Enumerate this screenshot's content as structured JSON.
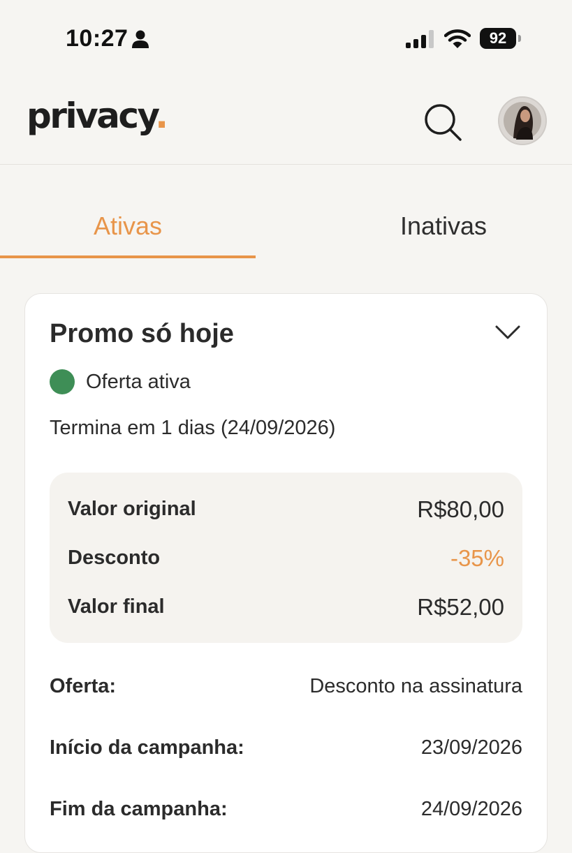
{
  "status_bar": {
    "time": "10:27",
    "battery": "92"
  },
  "header": {
    "logo_text": "privacy",
    "logo_dot": ".",
    "brand_color": "#e8954a"
  },
  "tabs": [
    {
      "label": "Ativas",
      "active": true
    },
    {
      "label": "Inativas",
      "active": false
    }
  ],
  "card": {
    "title": "Promo só hoje",
    "status": {
      "label": "Oferta ativa",
      "color": "#3e8e56"
    },
    "ends": "Termina em 1 dias (24/09/2026)",
    "prices": [
      {
        "label": "Valor original",
        "value": "R$80,00"
      },
      {
        "label": "Desconto",
        "value": "-35%"
      },
      {
        "label": "Valor final",
        "value": "R$52,00"
      }
    ],
    "details": [
      {
        "label": "Oferta:",
        "value": "Desconto na assinatura"
      },
      {
        "label": "Início da campanha:",
        "value": "23/09/2026"
      },
      {
        "label": "Fim da campanha:",
        "value": "24/09/2026"
      }
    ]
  }
}
